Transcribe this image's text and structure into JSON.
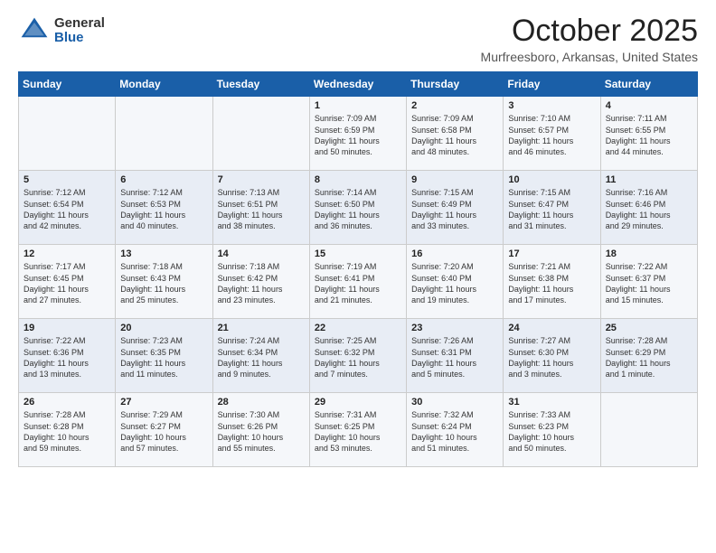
{
  "header": {
    "logo_general": "General",
    "logo_blue": "Blue",
    "title": "October 2025",
    "location": "Murfreesboro, Arkansas, United States"
  },
  "days_of_week": [
    "Sunday",
    "Monday",
    "Tuesday",
    "Wednesday",
    "Thursday",
    "Friday",
    "Saturday"
  ],
  "weeks": [
    [
      {
        "day": "",
        "info": ""
      },
      {
        "day": "",
        "info": ""
      },
      {
        "day": "",
        "info": ""
      },
      {
        "day": "1",
        "info": "Sunrise: 7:09 AM\nSunset: 6:59 PM\nDaylight: 11 hours\nand 50 minutes."
      },
      {
        "day": "2",
        "info": "Sunrise: 7:09 AM\nSunset: 6:58 PM\nDaylight: 11 hours\nand 48 minutes."
      },
      {
        "day": "3",
        "info": "Sunrise: 7:10 AM\nSunset: 6:57 PM\nDaylight: 11 hours\nand 46 minutes."
      },
      {
        "day": "4",
        "info": "Sunrise: 7:11 AM\nSunset: 6:55 PM\nDaylight: 11 hours\nand 44 minutes."
      }
    ],
    [
      {
        "day": "5",
        "info": "Sunrise: 7:12 AM\nSunset: 6:54 PM\nDaylight: 11 hours\nand 42 minutes."
      },
      {
        "day": "6",
        "info": "Sunrise: 7:12 AM\nSunset: 6:53 PM\nDaylight: 11 hours\nand 40 minutes."
      },
      {
        "day": "7",
        "info": "Sunrise: 7:13 AM\nSunset: 6:51 PM\nDaylight: 11 hours\nand 38 minutes."
      },
      {
        "day": "8",
        "info": "Sunrise: 7:14 AM\nSunset: 6:50 PM\nDaylight: 11 hours\nand 36 minutes."
      },
      {
        "day": "9",
        "info": "Sunrise: 7:15 AM\nSunset: 6:49 PM\nDaylight: 11 hours\nand 33 minutes."
      },
      {
        "day": "10",
        "info": "Sunrise: 7:15 AM\nSunset: 6:47 PM\nDaylight: 11 hours\nand 31 minutes."
      },
      {
        "day": "11",
        "info": "Sunrise: 7:16 AM\nSunset: 6:46 PM\nDaylight: 11 hours\nand 29 minutes."
      }
    ],
    [
      {
        "day": "12",
        "info": "Sunrise: 7:17 AM\nSunset: 6:45 PM\nDaylight: 11 hours\nand 27 minutes."
      },
      {
        "day": "13",
        "info": "Sunrise: 7:18 AM\nSunset: 6:43 PM\nDaylight: 11 hours\nand 25 minutes."
      },
      {
        "day": "14",
        "info": "Sunrise: 7:18 AM\nSunset: 6:42 PM\nDaylight: 11 hours\nand 23 minutes."
      },
      {
        "day": "15",
        "info": "Sunrise: 7:19 AM\nSunset: 6:41 PM\nDaylight: 11 hours\nand 21 minutes."
      },
      {
        "day": "16",
        "info": "Sunrise: 7:20 AM\nSunset: 6:40 PM\nDaylight: 11 hours\nand 19 minutes."
      },
      {
        "day": "17",
        "info": "Sunrise: 7:21 AM\nSunset: 6:38 PM\nDaylight: 11 hours\nand 17 minutes."
      },
      {
        "day": "18",
        "info": "Sunrise: 7:22 AM\nSunset: 6:37 PM\nDaylight: 11 hours\nand 15 minutes."
      }
    ],
    [
      {
        "day": "19",
        "info": "Sunrise: 7:22 AM\nSunset: 6:36 PM\nDaylight: 11 hours\nand 13 minutes."
      },
      {
        "day": "20",
        "info": "Sunrise: 7:23 AM\nSunset: 6:35 PM\nDaylight: 11 hours\nand 11 minutes."
      },
      {
        "day": "21",
        "info": "Sunrise: 7:24 AM\nSunset: 6:34 PM\nDaylight: 11 hours\nand 9 minutes."
      },
      {
        "day": "22",
        "info": "Sunrise: 7:25 AM\nSunset: 6:32 PM\nDaylight: 11 hours\nand 7 minutes."
      },
      {
        "day": "23",
        "info": "Sunrise: 7:26 AM\nSunset: 6:31 PM\nDaylight: 11 hours\nand 5 minutes."
      },
      {
        "day": "24",
        "info": "Sunrise: 7:27 AM\nSunset: 6:30 PM\nDaylight: 11 hours\nand 3 minutes."
      },
      {
        "day": "25",
        "info": "Sunrise: 7:28 AM\nSunset: 6:29 PM\nDaylight: 11 hours\nand 1 minute."
      }
    ],
    [
      {
        "day": "26",
        "info": "Sunrise: 7:28 AM\nSunset: 6:28 PM\nDaylight: 10 hours\nand 59 minutes."
      },
      {
        "day": "27",
        "info": "Sunrise: 7:29 AM\nSunset: 6:27 PM\nDaylight: 10 hours\nand 57 minutes."
      },
      {
        "day": "28",
        "info": "Sunrise: 7:30 AM\nSunset: 6:26 PM\nDaylight: 10 hours\nand 55 minutes."
      },
      {
        "day": "29",
        "info": "Sunrise: 7:31 AM\nSunset: 6:25 PM\nDaylight: 10 hours\nand 53 minutes."
      },
      {
        "day": "30",
        "info": "Sunrise: 7:32 AM\nSunset: 6:24 PM\nDaylight: 10 hours\nand 51 minutes."
      },
      {
        "day": "31",
        "info": "Sunrise: 7:33 AM\nSunset: 6:23 PM\nDaylight: 10 hours\nand 50 minutes."
      },
      {
        "day": "",
        "info": ""
      }
    ]
  ]
}
